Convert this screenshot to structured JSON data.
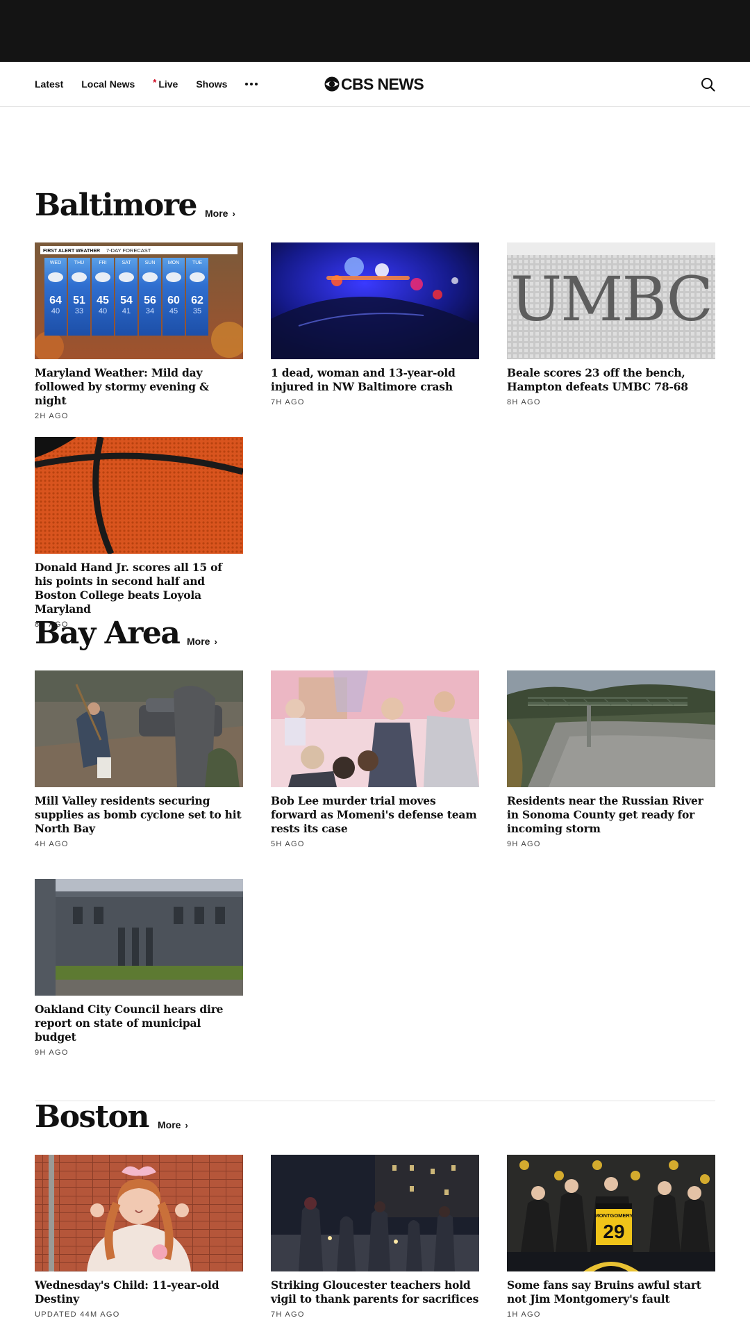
{
  "nav": {
    "links": [
      {
        "label": "Latest"
      },
      {
        "label": "Local News"
      },
      {
        "label": "Live",
        "live": true
      },
      {
        "label": "Shows"
      }
    ],
    "logo_text": "CBS NEWS"
  },
  "colors": {
    "live_dot": "#d0021b",
    "top_band": "#141414",
    "text": "#111111"
  },
  "icons": {
    "search": "search-icon",
    "more": "more-dots-icon",
    "logo": "cbs-eye-icon"
  },
  "sections": [
    {
      "title": "Baltimore",
      "more_label": "More",
      "articles": [
        {
          "headline": "Maryland Weather: Mild day followed by stormy evening & night",
          "time": "2H AGO",
          "image": "weather-forecast-graphic",
          "forecast": {
            "banner_left": "FIRST ALERT WEATHER",
            "banner_right": "7-DAY FORECAST",
            "days": [
              {
                "day": "WED",
                "hi": "64",
                "lo": "40"
              },
              {
                "day": "THU",
                "hi": "51",
                "lo": "33"
              },
              {
                "day": "FRI",
                "hi": "45",
                "lo": "40"
              },
              {
                "day": "SAT",
                "hi": "54",
                "lo": "41"
              },
              {
                "day": "SUN",
                "hi": "56",
                "lo": "34"
              },
              {
                "day": "MON",
                "hi": "60",
                "lo": "45"
              },
              {
                "day": "TUE",
                "hi": "62",
                "lo": "35"
              }
            ]
          }
        },
        {
          "headline": "1 dead, woman and 13-year-old injured in NW Baltimore crash",
          "time": "7H AGO",
          "image": "police-lights-photo"
        },
        {
          "headline": "Beale scores 23 off the bench, Hampton defeats UMBC 78-68",
          "time": "8H AGO",
          "image": "umbc-sign-photo",
          "sign_text": "UMBC"
        },
        {
          "headline": "Donald Hand Jr. scores all 15 of his points in second half and Boston College beats Loyola Maryland",
          "time": "8H AGO",
          "image": "basketball-photo"
        }
      ]
    },
    {
      "title": "Bay Area",
      "more_label": "More",
      "articles": [
        {
          "headline": "Mill Valley residents securing supplies as bomb cyclone set to hit North Bay",
          "time": "4H AGO",
          "image": "sandbags-photo"
        },
        {
          "headline": "Bob Lee murder trial moves forward as Momeni's defense team rests its case",
          "time": "5H AGO",
          "image": "courtroom-sketch"
        },
        {
          "headline": "Residents near the Russian River in Sonoma County get ready for incoming storm",
          "time": "9H AGO",
          "image": "river-bridge-photo"
        },
        {
          "headline": "Oakland City Council hears dire report on state of municipal budget",
          "time": "9H AGO",
          "image": "city-hall-photo"
        }
      ]
    },
    {
      "title": "Boston",
      "more_label": "More",
      "articles": [
        {
          "headline": "Wednesday's Child: 11-year-old Destiny",
          "time": "UPDATED 44M AGO",
          "image": "girl-portrait-photo"
        },
        {
          "headline": "Striking Gloucester teachers hold vigil to thank parents for sacrifices",
          "time": "7H AGO",
          "image": "night-vigil-photo"
        },
        {
          "headline": "Some fans say Bruins awful start not Jim Montgomery's fault",
          "time": "1H AGO",
          "image": "press-conference-photo",
          "jersey_text": "MONTGOMERY",
          "jersey_number": "29"
        }
      ]
    }
  ]
}
